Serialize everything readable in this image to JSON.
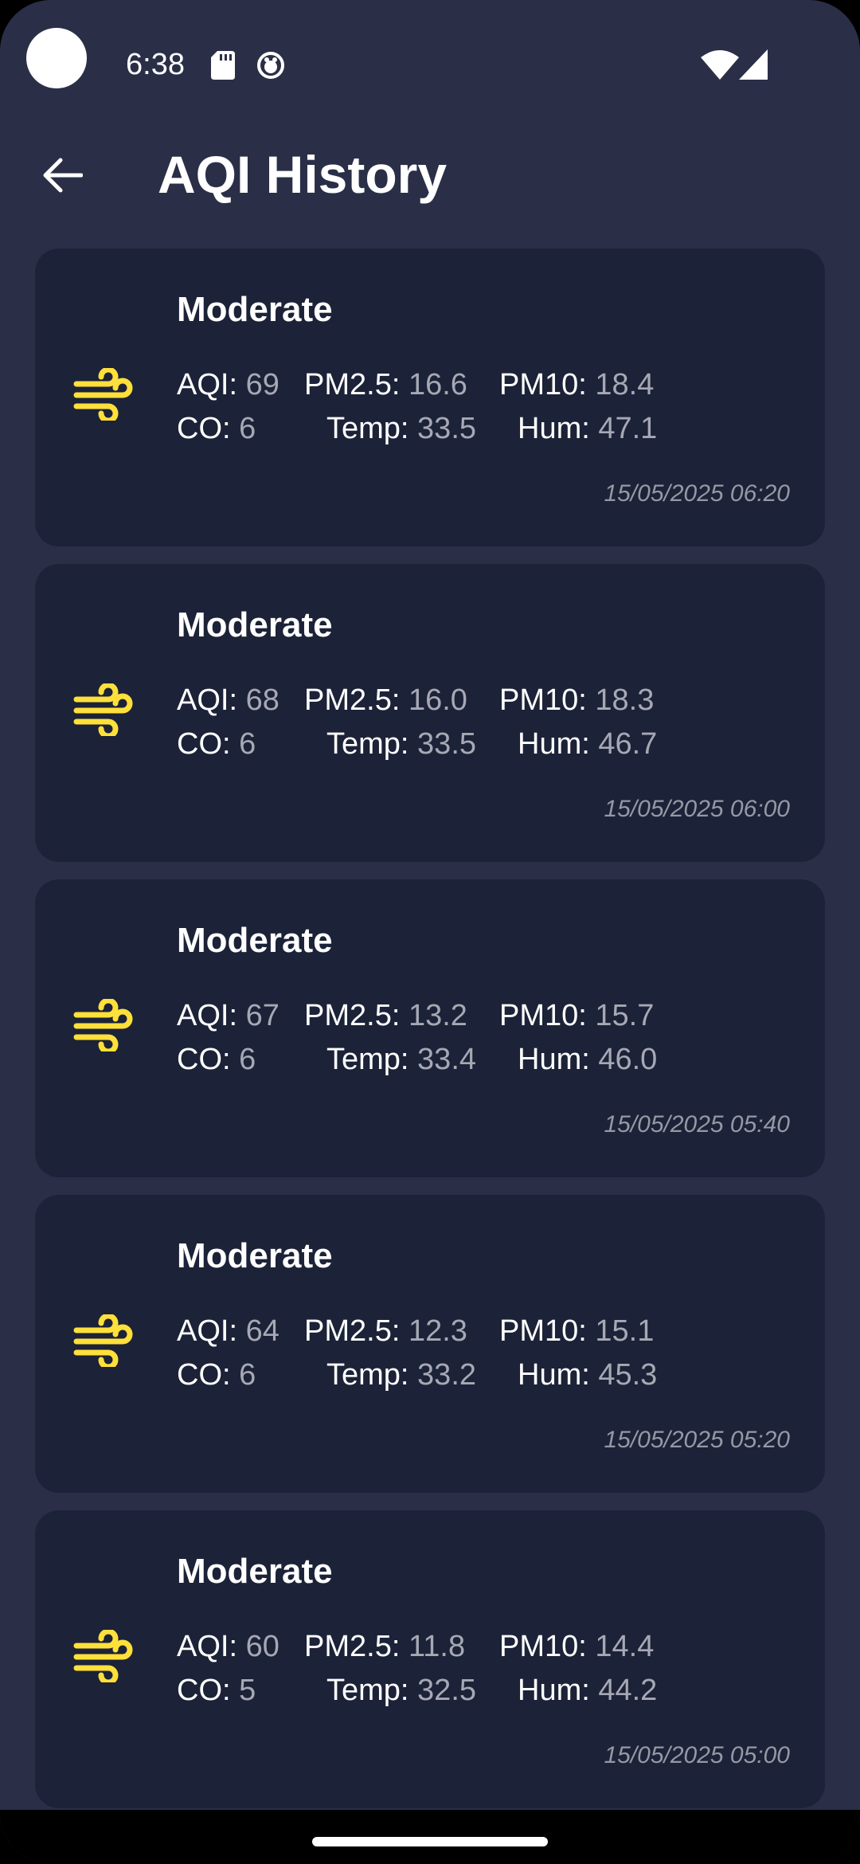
{
  "status_bar": {
    "time": "6:38",
    "icons": [
      "sd-card-icon",
      "notification-icon",
      "wifi-icon",
      "signal-icon"
    ]
  },
  "app_bar": {
    "title": "AQI History",
    "back_icon": "arrow-back-icon"
  },
  "colors": {
    "background": "#2a2f47",
    "card": "#1c2237",
    "accent_icon": "#ffe03a",
    "value_text": "#a6a9b4"
  },
  "labels": {
    "aqi": "AQI:",
    "pm25": "PM2.5:",
    "pm10": "PM10:",
    "co": "CO:",
    "temp": "Temp:",
    "hum": "Hum:"
  },
  "records": [
    {
      "status": "Moderate",
      "aqi": "69",
      "pm25": "16.6",
      "pm10": "18.4",
      "co": "6",
      "temp": "33.5",
      "hum": "47.1",
      "timestamp": "15/05/2025 06:20",
      "icon": "wind-icon"
    },
    {
      "status": "Moderate",
      "aqi": "68",
      "pm25": "16.0",
      "pm10": "18.3",
      "co": "6",
      "temp": "33.5",
      "hum": "46.7",
      "timestamp": "15/05/2025 06:00",
      "icon": "wind-icon"
    },
    {
      "status": "Moderate",
      "aqi": "67",
      "pm25": "13.2",
      "pm10": "15.7",
      "co": "6",
      "temp": "33.4",
      "hum": "46.0",
      "timestamp": "15/05/2025 05:40",
      "icon": "wind-icon"
    },
    {
      "status": "Moderate",
      "aqi": "64",
      "pm25": "12.3",
      "pm10": "15.1",
      "co": "6",
      "temp": "33.2",
      "hum": "45.3",
      "timestamp": "15/05/2025 05:20",
      "icon": "wind-icon"
    },
    {
      "status": "Moderate",
      "aqi": "60",
      "pm25": "11.8",
      "pm10": "14.4",
      "co": "5",
      "temp": "32.5",
      "hum": "44.2",
      "timestamp": "15/05/2025 05:00",
      "icon": "wind-icon"
    }
  ]
}
